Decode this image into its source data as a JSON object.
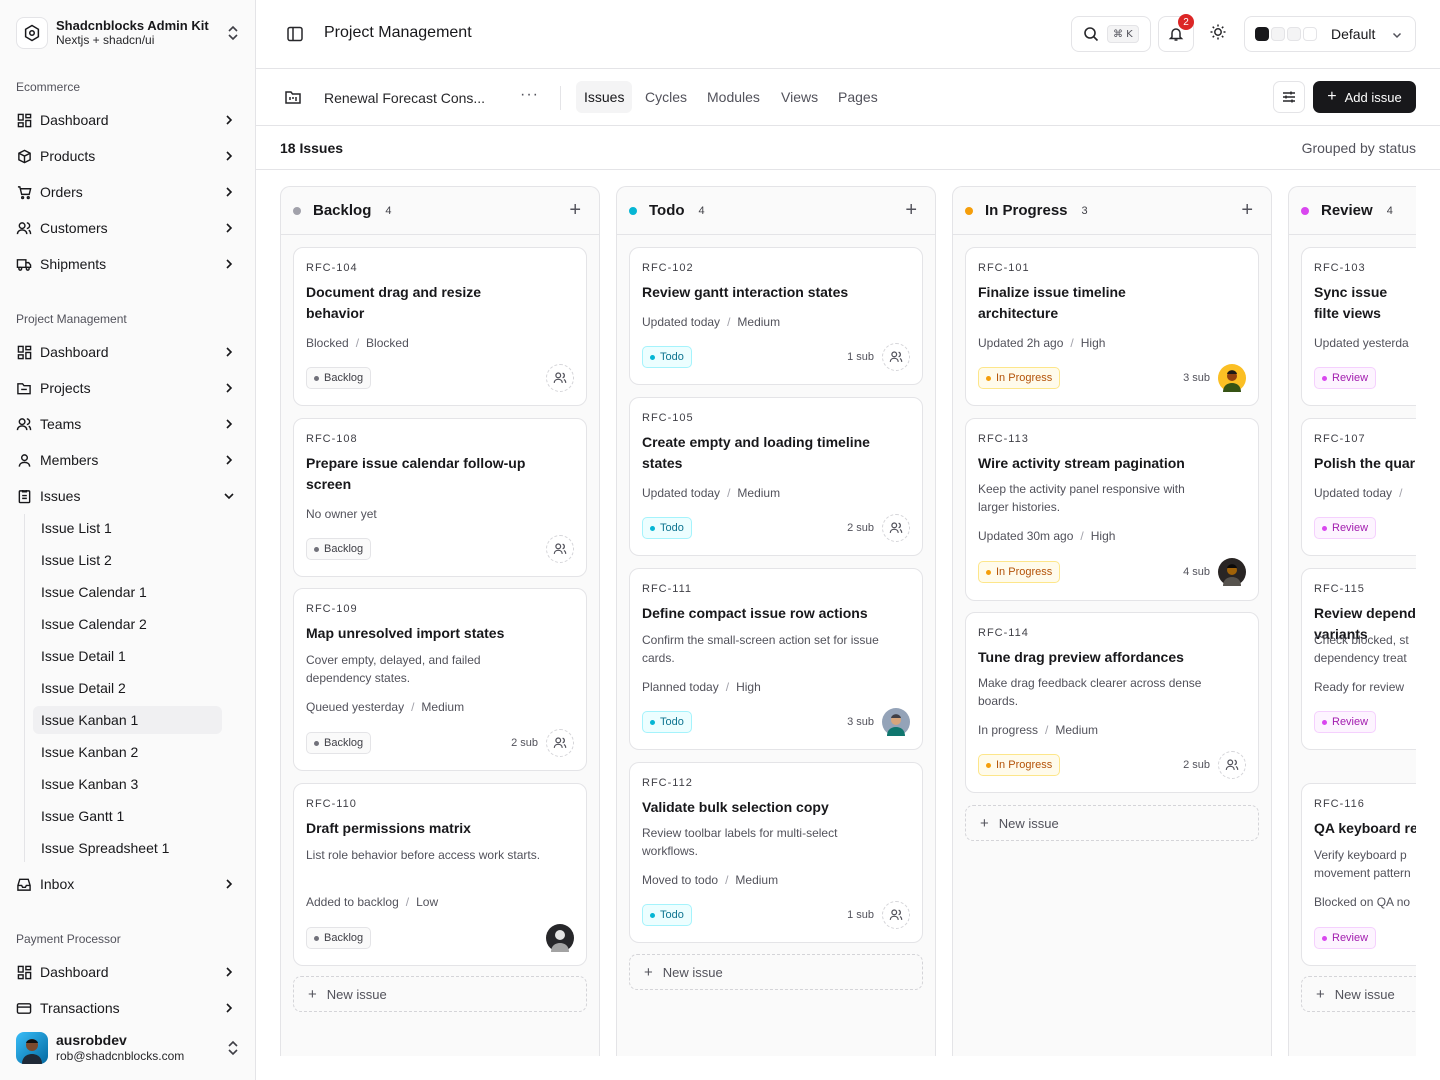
{
  "brand": {
    "name": "Shadcnblocks Admin Kit",
    "subtitle": "Nextjs + shadcn/ui"
  },
  "sidebar": {
    "sections": [
      {
        "label": "Ecommerce",
        "items": [
          "Dashboard",
          "Products",
          "Orders",
          "Customers",
          "Shipments"
        ]
      },
      {
        "label": "Project Management",
        "items": [
          "Dashboard",
          "Projects",
          "Teams",
          "Members",
          "Issues"
        ]
      },
      {
        "label": "Payment Processor",
        "items": [
          "Dashboard",
          "Transactions"
        ]
      }
    ],
    "issues_sub": [
      "Issue List 1",
      "Issue List 2",
      "Issue Calendar 1",
      "Issue Calendar 2",
      "Issue Detail 1",
      "Issue Detail 2",
      "Issue Kanban 1",
      "Issue Kanban 2",
      "Issue Kanban 3",
      "Issue Gantt 1",
      "Issue Spreadsheet 1"
    ],
    "inbox": "Inbox",
    "active_sub": "Issue Kanban 1"
  },
  "user": {
    "name": "ausrobdev",
    "email": "rob@shadcnblocks.com"
  },
  "header": {
    "title": "Project Management",
    "shortcut": "⌘ K",
    "notifications": "2",
    "theme": "Default"
  },
  "project": {
    "name": "Renewal Forecast Cons...",
    "more": "···",
    "tabs": [
      "Issues",
      "Cycles",
      "Modules",
      "Views",
      "Pages"
    ],
    "active_tab": "Issues",
    "add_label": "Add issue"
  },
  "summary": {
    "count": "18 Issues",
    "grouping": "Grouped by status"
  },
  "columns": [
    {
      "title": "Backlog",
      "count": "4",
      "color": "#a1a1aa"
    },
    {
      "title": "Todo",
      "count": "4",
      "color": "#06b6d4"
    },
    {
      "title": "In Progress",
      "count": "3",
      "color": "#f59e0b"
    },
    {
      "title": "Review",
      "count": "4",
      "color": "#d946ef"
    }
  ],
  "cards": {
    "backlog": [
      {
        "id": "RFC-104",
        "title": "Document drag and resize behavior",
        "desc": "",
        "meta1": "Blocked",
        "meta2": "Blocked",
        "status": "Backlog",
        "subs": ""
      },
      {
        "id": "RFC-108",
        "title": "Prepare issue calendar follow-up screen",
        "desc": "",
        "meta1": "No owner yet",
        "meta2": "",
        "status": "Backlog",
        "subs": ""
      },
      {
        "id": "RFC-109",
        "title": "Map unresolved import states",
        "desc": "Cover empty, delayed, and failed dependency states.",
        "meta1": "Queued yesterday",
        "meta2": "Medium",
        "status": "Backlog",
        "subs": "2 sub"
      },
      {
        "id": "RFC-110",
        "title": "Draft permissions matrix",
        "desc": "List role behavior before access work starts.",
        "meta1": "Added to backlog",
        "meta2": "Low",
        "status": "Backlog",
        "subs": ""
      }
    ],
    "todo": [
      {
        "id": "RFC-102",
        "title": "Review gantt interaction states",
        "desc": "",
        "meta1": "Updated today",
        "meta2": "Medium",
        "status": "Todo",
        "subs": "1 sub"
      },
      {
        "id": "RFC-105",
        "title": "Create empty and loading timeline states",
        "desc": "",
        "meta1": "Updated today",
        "meta2": "Medium",
        "status": "Todo",
        "subs": "2 sub"
      },
      {
        "id": "RFC-111",
        "title": "Define compact issue row actions",
        "desc": "Confirm the small-screen action set for issue cards.",
        "meta1": "Planned today",
        "meta2": "High",
        "status": "Todo",
        "subs": "3 sub"
      },
      {
        "id": "RFC-112",
        "title": "Validate bulk selection copy",
        "desc": "Review toolbar labels for multi-select workflows.",
        "meta1": "Moved to todo",
        "meta2": "Medium",
        "status": "Todo",
        "subs": "1 sub"
      }
    ],
    "progress": [
      {
        "id": "RFC-101",
        "title": "Finalize issue timeline architecture",
        "desc": "",
        "meta1": "Updated 2h ago",
        "meta2": "High",
        "status": "In Progress",
        "subs": "3 sub"
      },
      {
        "id": "RFC-113",
        "title": "Wire activity stream pagination",
        "desc": "Keep the activity panel responsive with larger histories.",
        "meta1": "Updated 30m ago",
        "meta2": "High",
        "status": "In Progress",
        "subs": "4 sub"
      },
      {
        "id": "RFC-114",
        "title": "Tune drag preview affordances",
        "desc": "Make drag feedback clearer across dense boards.",
        "meta1": "In progress",
        "meta2": "Medium",
        "status": "In Progress",
        "subs": "2 sub"
      }
    ],
    "review": [
      {
        "id": "RFC-103",
        "title": "Sync issue filte views",
        "desc": "",
        "meta1": "Updated yesterda",
        "meta2": "",
        "status": "Review",
        "subs": ""
      },
      {
        "id": "RFC-107",
        "title": "Polish the quar",
        "desc": "",
        "meta1": "Updated today",
        "meta2": "",
        "status": "Review",
        "subs": ""
      },
      {
        "id": "RFC-115",
        "title": "Review depend variants",
        "desc": "Check blocked, st dependency treat",
        "meta1": "Ready for review",
        "meta2": "",
        "status": "Review",
        "subs": ""
      },
      {
        "id": "RFC-116",
        "title": "QA keyboard re",
        "desc": "Verify keyboard p movement pattern",
        "meta1": "Blocked on QA no",
        "meta2": "",
        "status": "Review",
        "subs": ""
      }
    ]
  },
  "new_issue_label": "New issue"
}
